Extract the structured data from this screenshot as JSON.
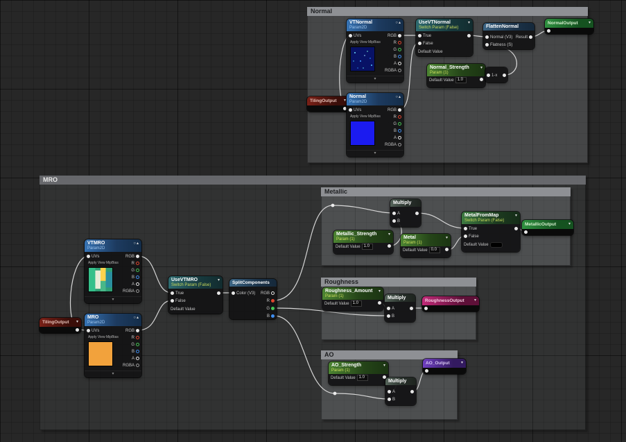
{
  "comments": {
    "normal": {
      "title": "Normal"
    },
    "mro": {
      "title": "MRO"
    },
    "metallic": {
      "title": "Metallic"
    },
    "roughness": {
      "title": "Roughness"
    },
    "ao": {
      "title": "AO"
    }
  },
  "labels": {
    "uvs": "UVs",
    "mipbias": "Apply View MipBias",
    "rgb": "RGB",
    "r": "R",
    "g": "G",
    "b": "B",
    "a": "A",
    "rgba": "RGBA",
    "true_label": "True",
    "false_label": "False",
    "default_value": "Default Value",
    "a_label": "A",
    "b_label": "B",
    "color_v3": "Color (V3)",
    "normal_v3": "Normal (V3)",
    "flatness_s": "Flatness (S)",
    "result": "Result"
  },
  "icons": {
    "preview": "○",
    "collapse_up": "▴",
    "collapse_down": "▾"
  },
  "nodes": {
    "tiling_top": {
      "title": "TilingOutput"
    },
    "vtnormal": {
      "title": "VTNormal",
      "subtitle": "Param2D"
    },
    "normal_tex": {
      "title": "Normal",
      "subtitle": "Param2D"
    },
    "use_vtnormal": {
      "title": "UseVTNormal",
      "subtitle": "Switch Param (False)"
    },
    "flatten_normal": {
      "title": "FlattenNormal"
    },
    "normal_strength": {
      "title": "Normal_Strength",
      "subtitle": "Param (1)",
      "value": "1.0"
    },
    "one_minus": {
      "title": "1-x"
    },
    "normal_output": {
      "title": "NormalOutput"
    },
    "vtmro": {
      "title": "VTMRO",
      "subtitle": "Param2D"
    },
    "mro_tex": {
      "title": "MRO",
      "subtitle": "Param2D"
    },
    "tiling_bottom": {
      "title": "TilingOutput"
    },
    "use_vtmro": {
      "title": "UseVTMRO",
      "subtitle": "Switch Param (False)"
    },
    "split_components": {
      "title": "SplitComponents"
    },
    "metallic_strength": {
      "title": "Metallic_Strength",
      "subtitle": "Param (1)",
      "value": "1.0"
    },
    "multiply_metallic": {
      "title": "Multiply"
    },
    "metal": {
      "title": "Metal",
      "subtitle": "Param (1)",
      "value": "0.0"
    },
    "metal_from_map": {
      "title": "MetalFromMap",
      "subtitle": "Switch Param (False)"
    },
    "metallic_output": {
      "title": "MetallicOutput"
    },
    "roughness_amount": {
      "title": "Roughness_Amount",
      "subtitle": "Param (1)",
      "value": "1.0"
    },
    "multiply_roughness": {
      "title": "Multiply"
    },
    "roughness_output": {
      "title": "RoughnessOutput"
    },
    "ao_strength": {
      "title": "AO_Strength",
      "subtitle": "Param (1)",
      "value": "1.0"
    },
    "multiply_ao": {
      "title": "Multiply"
    },
    "ao_output": {
      "title": "AO_Output"
    }
  }
}
